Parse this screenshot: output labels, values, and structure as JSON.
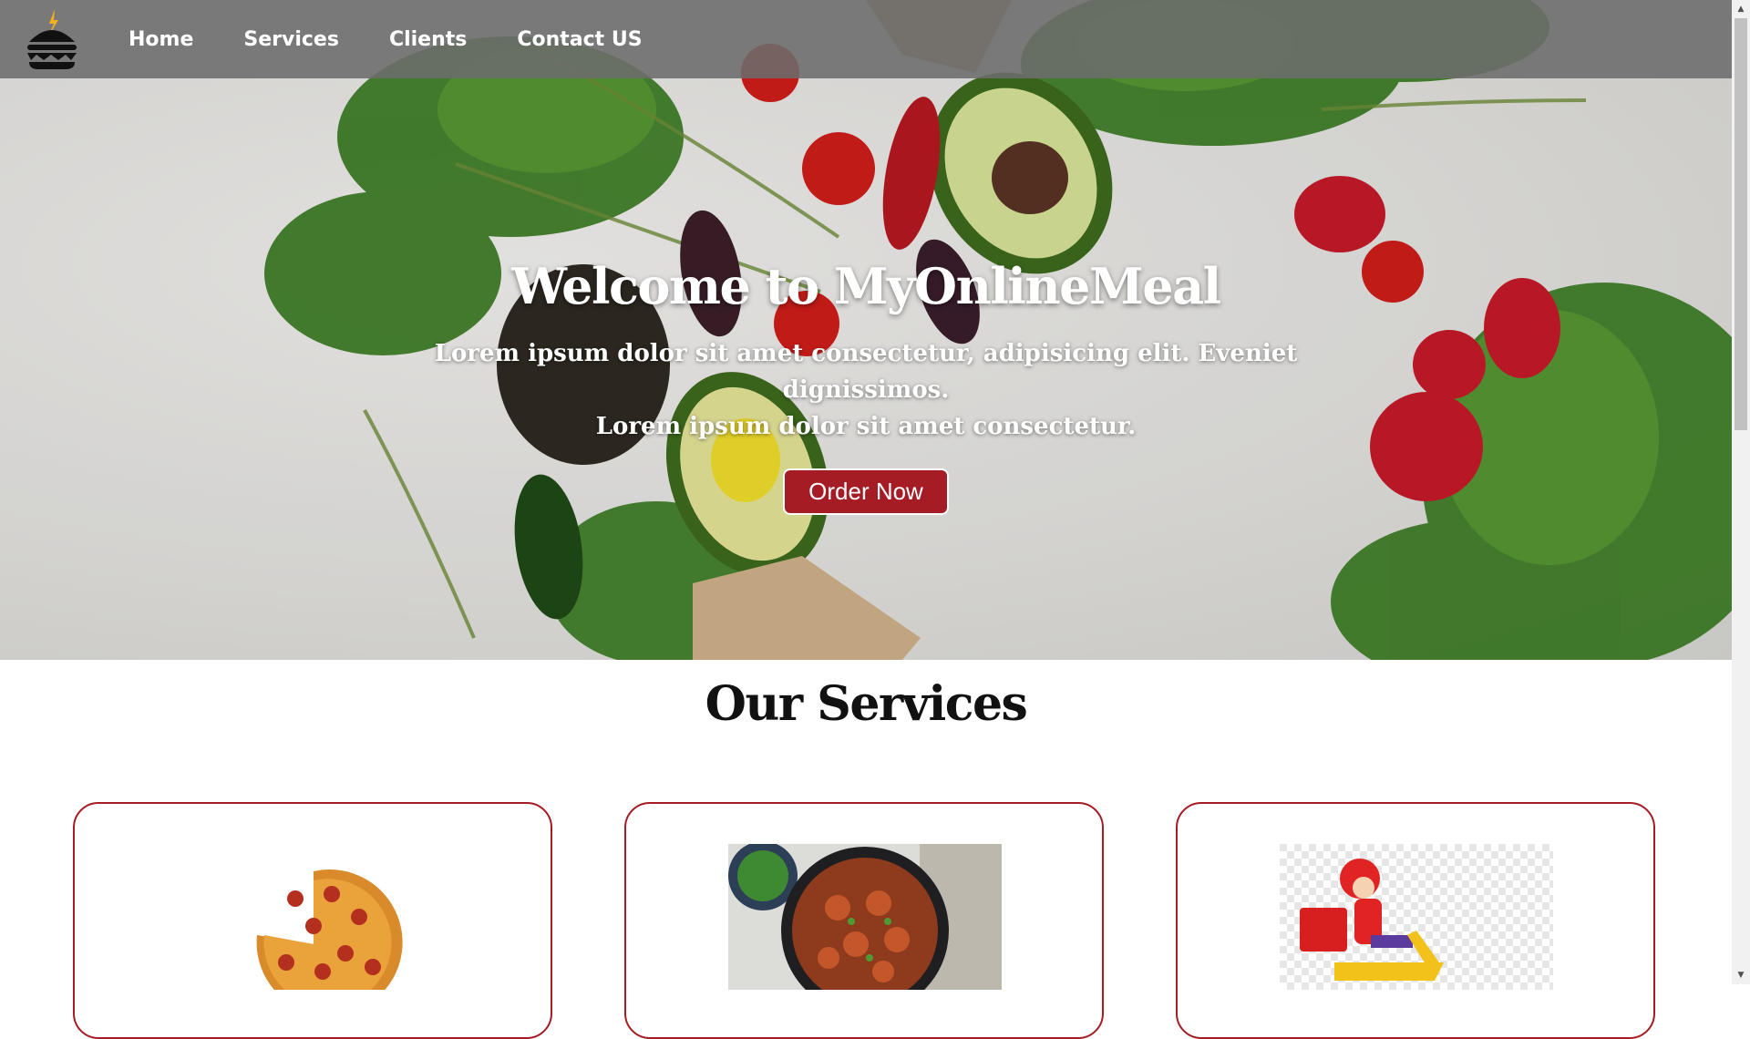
{
  "nav": {
    "links": [
      {
        "label": "Home"
      },
      {
        "label": "Services"
      },
      {
        "label": "Clients"
      },
      {
        "label": "Contact US"
      }
    ]
  },
  "hero": {
    "title": "Welcome to MyOnlineMeal",
    "subtitle_line1": "Lorem ipsum dolor sit amet consectetur, adipisicing elit. Eveniet dignissimos.",
    "subtitle_line2": "Lorem ipsum dolor sit amet consectetur.",
    "cta_label": "Order Now"
  },
  "services": {
    "title": "Our Services",
    "cards": [
      {
        "icon": "pizza-image"
      },
      {
        "icon": "curry-dish-image"
      },
      {
        "icon": "delivery-scooter-image"
      }
    ]
  },
  "colors": {
    "accent": "#a51c24",
    "navbar": "#6c6c6c",
    "hero_text": "#ffffff"
  }
}
